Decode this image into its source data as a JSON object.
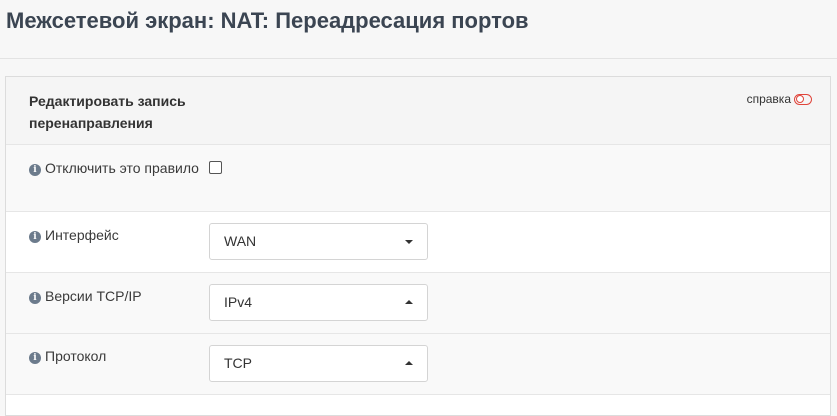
{
  "header": {
    "title": "Межсетевой экран: NAT: Переадресация портов"
  },
  "form": {
    "section_title": "Редактировать запись перенаправления",
    "help_label": "справка",
    "fields": {
      "disable": {
        "label": "Отключить это правило",
        "checked": false
      },
      "interface": {
        "label": "Интерфейс",
        "value": "WAN",
        "caret": "down"
      },
      "tcpip_version": {
        "label": "Версии TCP/IP",
        "value": "IPv4",
        "caret": "up"
      },
      "protocol": {
        "label": "Протокол",
        "value": "TCP",
        "caret": "up"
      }
    }
  },
  "icons": {
    "info": "info-circle-icon",
    "help_toggle": "toggle-off-icon"
  },
  "colors": {
    "title": "#3b4552",
    "help_toggle": "#e0443a",
    "info_icon": "#6c7b8c"
  }
}
